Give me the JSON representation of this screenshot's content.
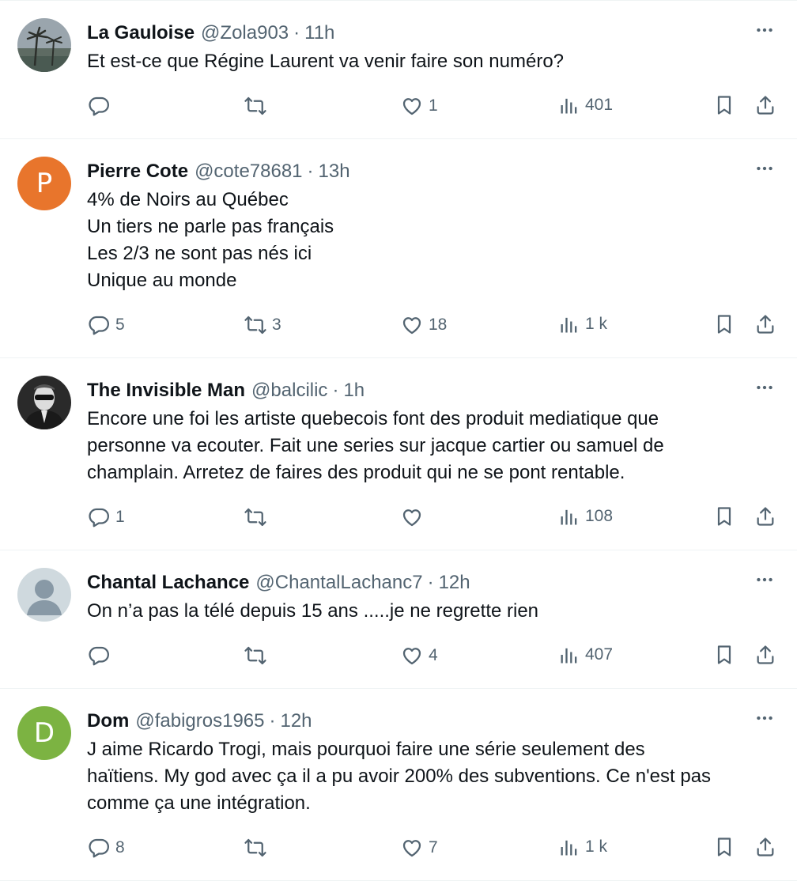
{
  "tweets": [
    {
      "name": "La Gauloise",
      "handle": "@Zola903",
      "dot": "·",
      "time": "11h",
      "avatar": {
        "type": "photo",
        "icon": "palm-trees-photo"
      },
      "lines": [
        "Et est-ce que Régine Laurent va venir faire son numéro?"
      ],
      "replies": "",
      "retweets": "",
      "likes": "1",
      "views": "401"
    },
    {
      "name": "Pierre Cote",
      "handle": "@cote78681",
      "dot": "·",
      "time": "13h",
      "avatar": {
        "type": "letter",
        "letter": "P",
        "color": "#e8752c"
      },
      "lines": [
        "4% de Noirs au Québec",
        "Un tiers ne parle pas français",
        "Les 2/3 ne sont pas nés ici",
        "Unique au monde"
      ],
      "replies": "5",
      "retweets": "3",
      "likes": "18",
      "views": "1 k"
    },
    {
      "name": "The Invisible Man",
      "handle": "@balcilic",
      "dot": "·",
      "time": "1h",
      "avatar": {
        "type": "photo",
        "icon": "invisible-man-photo"
      },
      "lines": [
        "Encore une foi les artiste quebecois font des produit mediatique que",
        "personne va ecouter. Fait une series sur jacque cartier ou samuel de",
        "champlain. Arretez de faires des produit qui ne se pont rentable."
      ],
      "replies": "1",
      "retweets": "",
      "likes": "",
      "views": "108"
    },
    {
      "name": "Chantal Lachance",
      "handle": "@ChantalLachanc7",
      "dot": "·",
      "time": "12h",
      "avatar": {
        "type": "default",
        "icon": "default-user-icon"
      },
      "lines": [
        "On n’a pas la télé depuis 15 ans .....je ne regrette rien"
      ],
      "replies": "",
      "retweets": "",
      "likes": "4",
      "views": "407"
    },
    {
      "name": "Dom",
      "handle": "@fabigros1965",
      "dot": "·",
      "time": "12h",
      "avatar": {
        "type": "letter",
        "letter": "D",
        "color": "#7cb342"
      },
      "lines": [
        "J aime Ricardo Trogi, mais pourquoi faire une série seulement des",
        "haïtiens. My god avec ça il a pu avoir 200% des subventions. Ce n'est pas",
        "comme ça une intégration."
      ],
      "replies": "8",
      "retweets": "",
      "likes": "7",
      "views": "1 k"
    }
  ],
  "colors": {
    "text": "#0f1419",
    "secondary": "#536471",
    "divider": "#eff3f4"
  }
}
